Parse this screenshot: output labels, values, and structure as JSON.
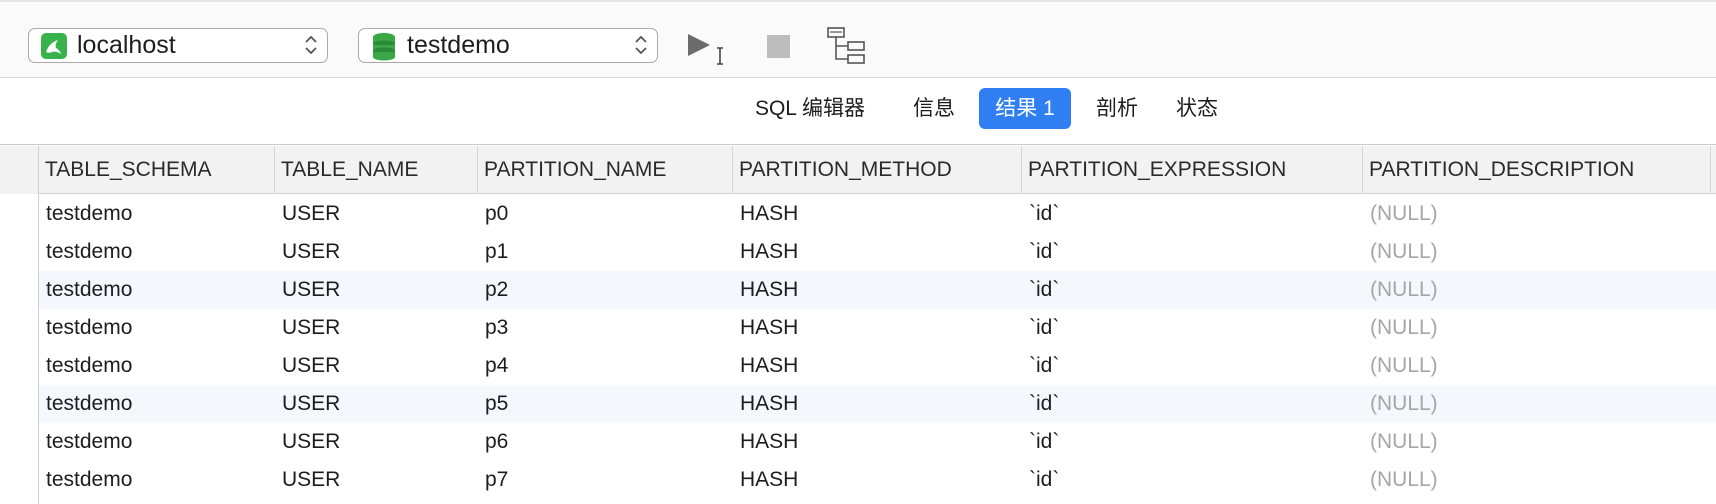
{
  "toolbar": {
    "connection": {
      "label": "localhost",
      "icon": "mysql-dolphin-icon",
      "icon_color": "#38b24a"
    },
    "database": {
      "label": "testdemo",
      "icon": "database-stack-icon",
      "icon_color": "#3aa845"
    },
    "run_icon": "play-icon",
    "stop_icon": "stop-icon",
    "explain_icon": "explain-tree-icon"
  },
  "tabs": [
    {
      "label": "SQL 编辑器",
      "active": false
    },
    {
      "label": "信息",
      "active": false
    },
    {
      "label": "结果 1",
      "active": true
    },
    {
      "label": "剖析",
      "active": false
    },
    {
      "label": "状态",
      "active": false
    }
  ],
  "accent_color": "#2f7ff3",
  "results": {
    "columns": [
      "TABLE_SCHEMA",
      "TABLE_NAME",
      "PARTITION_NAME",
      "PARTITION_METHOD",
      "PARTITION_EXPRESSION",
      "PARTITION_DESCRIPTION"
    ],
    "rows": [
      [
        "testdemo",
        "USER",
        "p0",
        "HASH",
        "`id`",
        "(NULL)"
      ],
      [
        "testdemo",
        "USER",
        "p1",
        "HASH",
        "`id`",
        "(NULL)"
      ],
      [
        "testdemo",
        "USER",
        "p2",
        "HASH",
        "`id`",
        "(NULL)"
      ],
      [
        "testdemo",
        "USER",
        "p3",
        "HASH",
        "`id`",
        "(NULL)"
      ],
      [
        "testdemo",
        "USER",
        "p4",
        "HASH",
        "`id`",
        "(NULL)"
      ],
      [
        "testdemo",
        "USER",
        "p5",
        "HASH",
        "`id`",
        "(NULL)"
      ],
      [
        "testdemo",
        "USER",
        "p6",
        "HASH",
        "`id`",
        "(NULL)"
      ],
      [
        "testdemo",
        "USER",
        "p7",
        "HASH",
        "`id`",
        "(NULL)"
      ]
    ]
  }
}
